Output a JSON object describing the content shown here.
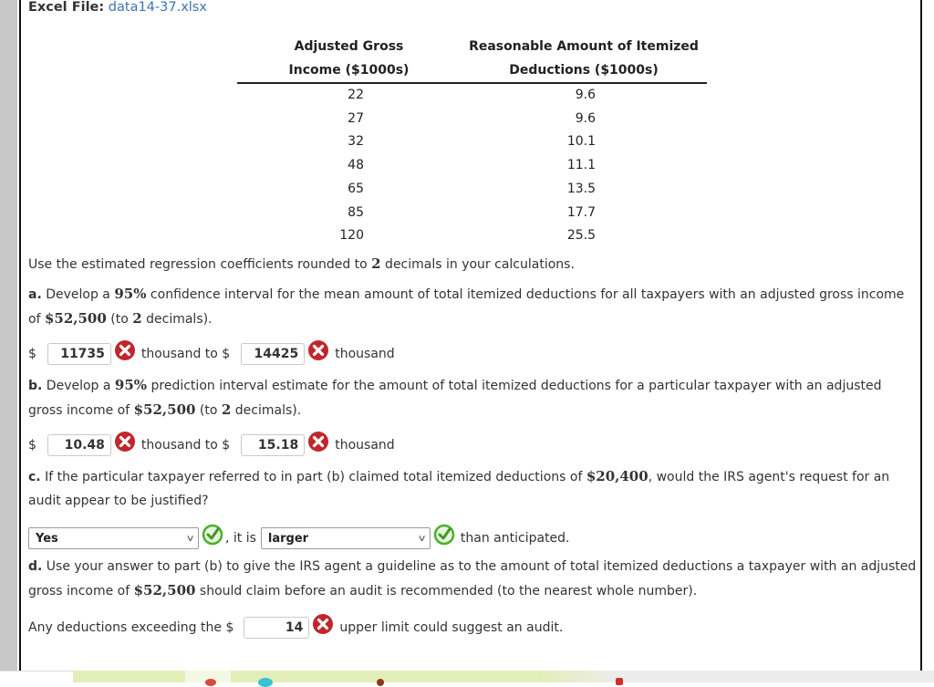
{
  "header": {
    "file_label": "Excel File:",
    "file_link": "data14-37.xlsx"
  },
  "table": {
    "columns": [
      {
        "line1": "Adjusted Gross",
        "line2": "Income ($1000s)"
      },
      {
        "line1": "Reasonable Amount of Itemized",
        "line2": "Deductions ($1000s)"
      }
    ],
    "rows": [
      [
        "22",
        "9.6"
      ],
      [
        "27",
        "9.6"
      ],
      [
        "32",
        "10.1"
      ],
      [
        "48",
        "11.1"
      ],
      [
        "65",
        "13.5"
      ],
      [
        "85",
        "17.7"
      ],
      [
        "120",
        "25.5"
      ]
    ]
  },
  "instruction": {
    "pre": "Use the estimated regression coefficients rounded to ",
    "num": "2",
    "post": " decimals in your calculations."
  },
  "part_a": {
    "letter": "a.",
    "t1": " Develop a ",
    "pct": "95%",
    "t2": " confidence interval for the mean amount of total itemized deductions for all taxpayers with an adjusted gross income of ",
    "amount": "$52,500",
    "t3": " (to ",
    "dec": "2",
    "t4": " decimals).",
    "answer": {
      "dollar": "$",
      "lower": "11735",
      "lower_status": "incorrect",
      "mid": "thousand to $",
      "upper": "14425",
      "upper_status": "incorrect",
      "end": "thousand"
    }
  },
  "part_b": {
    "letter": "b.",
    "t1": " Develop a ",
    "pct": "95%",
    "t2": " prediction interval estimate for the amount of total itemized deductions for a particular taxpayer with an adjusted gross income of ",
    "amount": "$52,500",
    "t3": " (to ",
    "dec": "2",
    "t4": " decimals).",
    "answer": {
      "dollar": "$",
      "lower": "10.48",
      "lower_status": "incorrect",
      "mid": "thousand to $",
      "upper": "15.18",
      "upper_status": "incorrect",
      "end": "thousand"
    }
  },
  "part_c": {
    "letter": "c.",
    "t1": " If the particular taxpayer referred to in part (b) claimed total itemized deductions of ",
    "amount": "$20,400",
    "t2": ", would the IRS agent's request for an audit appear to be justified?",
    "answer": {
      "select1": "Yes",
      "select1_status": "correct",
      "mid": ", it is",
      "select2": "larger",
      "select2_status": "correct",
      "end": "than anticipated."
    }
  },
  "part_d": {
    "letter": "d.",
    "t1": " Use your answer to part (b) to give the IRS agent a guideline as to the amount of total itemized deductions a taxpayer with an adjusted gross income of ",
    "amount": "$52,500",
    "t2": " should claim before an audit is recommended (to the nearest whole number).",
    "answer": {
      "pre": "Any deductions exceeding the $",
      "value": "14",
      "status": "incorrect",
      "post": "upper limit could suggest an audit."
    }
  },
  "colors": {
    "link": "#3c73b6",
    "incorrect": "#c0262c",
    "correct": "#4caf2a"
  }
}
